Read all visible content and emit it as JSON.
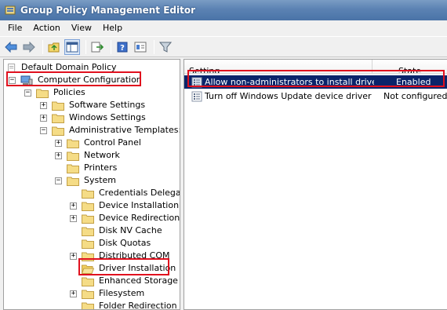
{
  "window": {
    "title": "Group Policy Management Editor"
  },
  "menu": [
    "File",
    "Action",
    "View",
    "Help"
  ],
  "toolbar": {
    "icons": [
      "back-arrow-icon",
      "forward-arrow-icon",
      "up-folder-icon",
      "show-hide-tree-icon",
      "export-list-icon",
      "help-icon",
      "properties-icon",
      "filter-icon"
    ]
  },
  "tree": {
    "root": "Default Domain Policy",
    "computer_configuration": "Computer Configuration",
    "policies": "Policies",
    "software_settings": "Software Settings",
    "windows_settings": "Windows Settings",
    "administrative_templates": "Administrative Templates: P",
    "control_panel": "Control Panel",
    "network": "Network",
    "printers": "Printers",
    "system": "System",
    "credentials_delegation": "Credentials Delegati",
    "device_installation": "Device Installation",
    "device_redirection": "Device Redirection",
    "disk_nv_cache": "Disk NV Cache",
    "disk_quotas": "Disk Quotas",
    "distributed_com": "Distributed COM",
    "driver_installation": "Driver Installation",
    "enhanced_storage": "Enhanced Storage",
    "filesystem": "Filesystem",
    "folder_redirection": "Folder Redirection"
  },
  "list": {
    "columns": {
      "setting": "Setting",
      "state": "State"
    },
    "rows": [
      {
        "setting": "Allow non-administrators to install drivers ...",
        "state": "Enabled"
      },
      {
        "setting": "Turn off Windows Update device driver s...",
        "state": "Not configured"
      }
    ]
  },
  "colors": {
    "highlight": "#e0101e",
    "selection": "#0a246a",
    "titlebar": "#5b82b3"
  }
}
